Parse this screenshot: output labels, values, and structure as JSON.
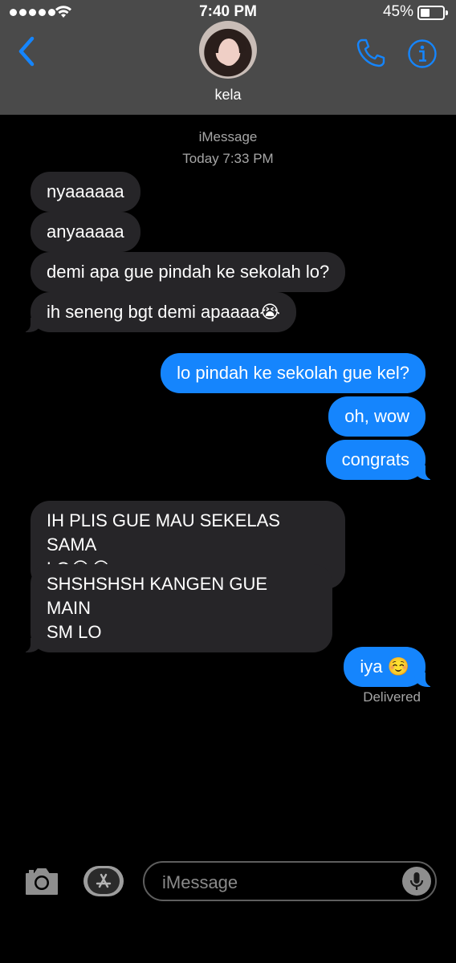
{
  "status_bar": {
    "time": "7:40 PM",
    "battery": "45%",
    "battery_level": 0.45
  },
  "header": {
    "contact_name": "kela"
  },
  "thread": {
    "service": "iMessage",
    "timestamp": "Today 7:33 PM",
    "messages": [
      {
        "dir": "in",
        "text": "nyaaaaaa"
      },
      {
        "dir": "in",
        "text": "anyaaaaa"
      },
      {
        "dir": "in",
        "text": "demi apa gue pindah ke sekolah lo?"
      },
      {
        "dir": "in",
        "text": "ih seneng bgt demi apaaaa😭"
      },
      {
        "dir": "out",
        "text": "lo pindah ke sekolah gue kel?"
      },
      {
        "dir": "out",
        "text": "oh, wow"
      },
      {
        "dir": "out",
        "text": "congrats"
      },
      {
        "dir": "in",
        "text": "IH PLIS GUE MAU SEKELAS SAMA\nLO😭😭"
      },
      {
        "dir": "in",
        "text": "SHSHSHSH KANGEN GUE MAIN\nSM LO"
      },
      {
        "dir": "out",
        "text": "iya ☺️"
      }
    ],
    "delivered": "Delivered"
  },
  "composer": {
    "placeholder": "iMessage"
  },
  "colors": {
    "outgoing": "#1585fd",
    "incoming": "#262528",
    "accent": "#1585fd",
    "header_bg": "#4a4a4a"
  },
  "icons": [
    "back-chevron-icon",
    "phone-icon",
    "info-icon",
    "camera-icon",
    "app-store-icon",
    "microphone-icon"
  ]
}
